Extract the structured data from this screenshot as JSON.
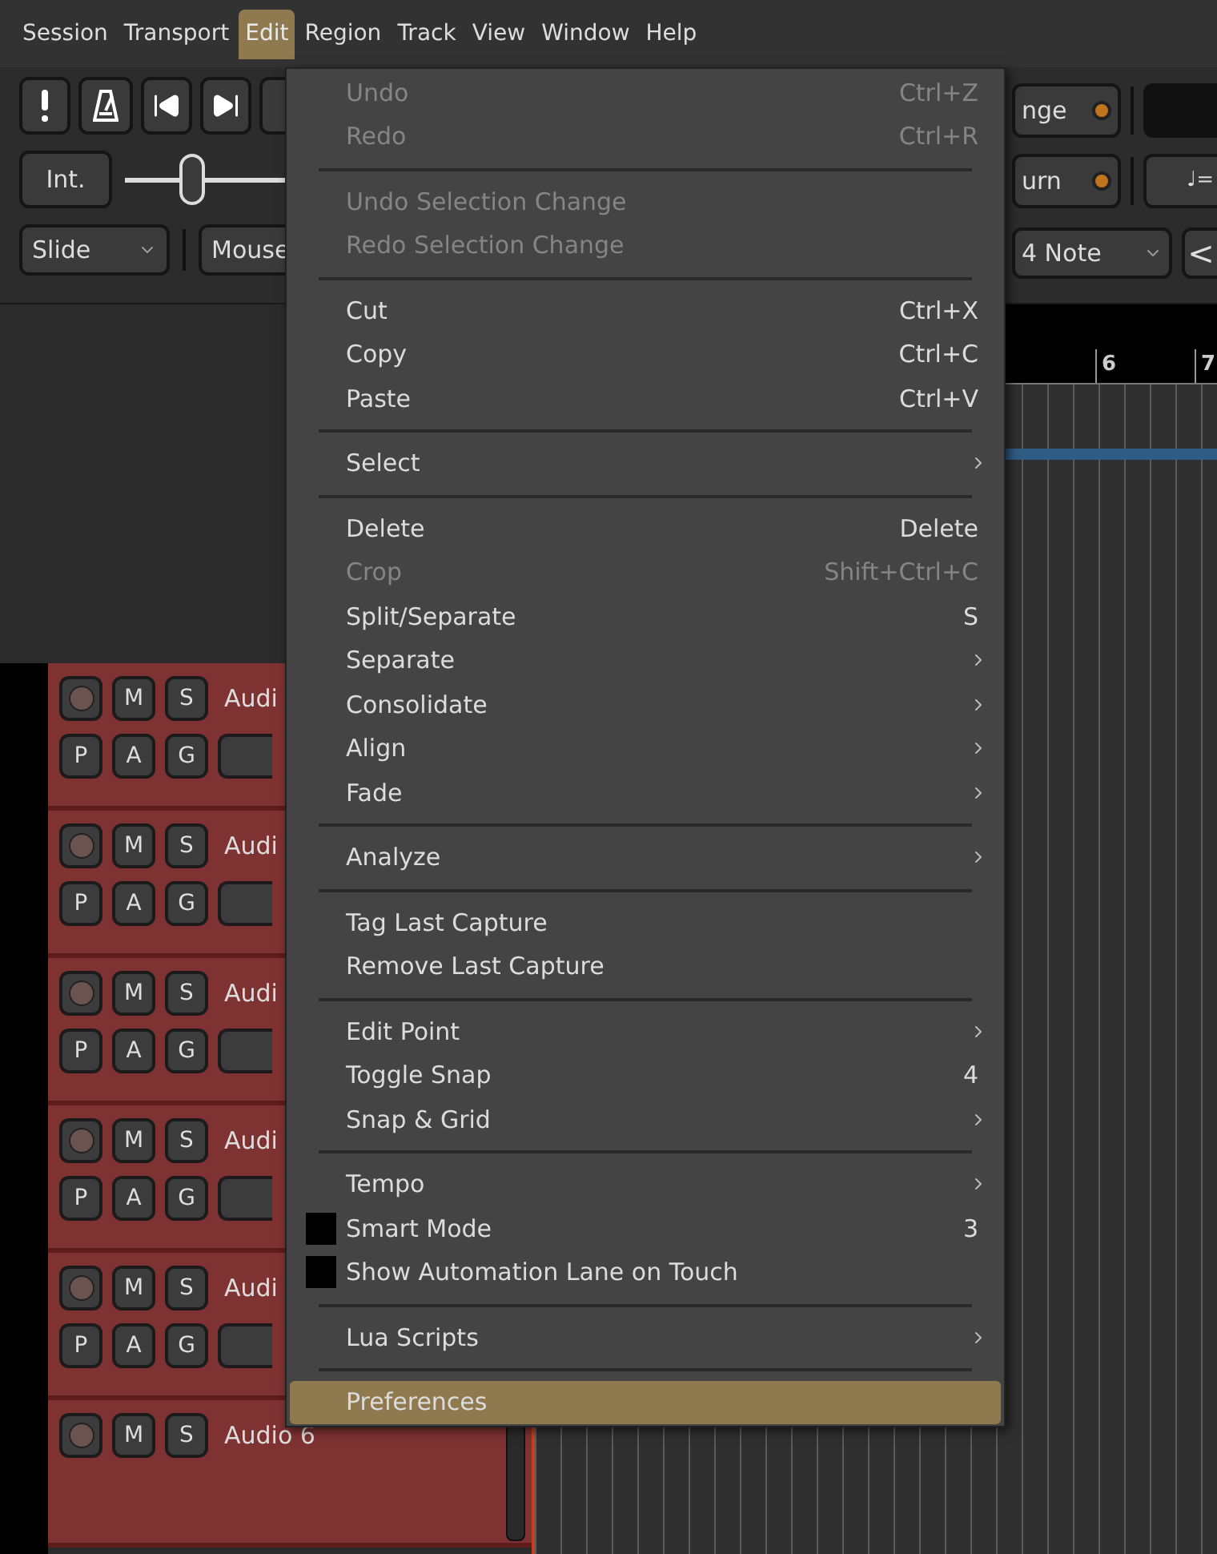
{
  "menubar": [
    {
      "label": "Session",
      "selected": false
    },
    {
      "label": "Transport",
      "selected": false
    },
    {
      "label": "Edit",
      "selected": true
    },
    {
      "label": "Region",
      "selected": false
    },
    {
      "label": "Track",
      "selected": false
    },
    {
      "label": "View",
      "selected": false
    },
    {
      "label": "Window",
      "selected": false
    },
    {
      "label": "Help",
      "selected": false
    }
  ],
  "toolbar": {
    "int_button": "Int.",
    "shuttle": {
      "level": 0.42
    },
    "range_button": "nge",
    "return_button": "urn",
    "tempo_button": "♩=",
    "edit_mode": "Slide",
    "mouse_mode": "Mouse",
    "grid_mode": "4 Note",
    "nudge_button": "<"
  },
  "ruler": {
    "labels": [
      "6",
      "7"
    ]
  },
  "tracks": [
    {
      "name": "Audi",
      "top_buttons": [
        "M",
        "S"
      ],
      "bottom_buttons": [
        "P",
        "A",
        "G"
      ]
    },
    {
      "name": "Audi",
      "top_buttons": [
        "M",
        "S"
      ],
      "bottom_buttons": [
        "P",
        "A",
        "G"
      ]
    },
    {
      "name": "Audi",
      "top_buttons": [
        "M",
        "S"
      ],
      "bottom_buttons": [
        "P",
        "A",
        "G"
      ]
    },
    {
      "name": "Audi",
      "top_buttons": [
        "M",
        "S"
      ],
      "bottom_buttons": [
        "P",
        "A",
        "G"
      ]
    },
    {
      "name": "Audi",
      "top_buttons": [
        "M",
        "S"
      ],
      "bottom_buttons": [
        "P",
        "A",
        "G"
      ]
    },
    {
      "name": "Audio 6",
      "top_buttons": [
        "M",
        "S"
      ]
    }
  ],
  "edit_menu": {
    "groups": [
      {
        "items": [
          {
            "kind": "normal",
            "label": "Undo",
            "shortcut": "Ctrl+Z",
            "disabled": true,
            "submenu": false,
            "selected": false
          },
          {
            "kind": "normal",
            "label": "Redo",
            "shortcut": "Ctrl+R",
            "disabled": true,
            "submenu": false,
            "selected": false
          }
        ]
      },
      {
        "items": [
          {
            "kind": "normal",
            "label": "Undo Selection Change",
            "disabled": true,
            "submenu": false,
            "selected": false
          },
          {
            "kind": "normal",
            "label": "Redo Selection Change",
            "disabled": true,
            "submenu": false,
            "selected": false
          }
        ]
      },
      {
        "items": [
          {
            "kind": "normal",
            "label": "Cut",
            "shortcut": "Ctrl+X",
            "disabled": false,
            "submenu": false,
            "selected": false
          },
          {
            "kind": "normal",
            "label": "Copy",
            "shortcut": "Ctrl+C",
            "disabled": false,
            "submenu": false,
            "selected": false
          },
          {
            "kind": "normal",
            "label": "Paste",
            "shortcut": "Ctrl+V",
            "disabled": false,
            "submenu": false,
            "selected": false
          }
        ]
      },
      {
        "items": [
          {
            "kind": "normal",
            "label": "Select",
            "disabled": false,
            "submenu": true,
            "selected": false
          }
        ]
      },
      {
        "items": [
          {
            "kind": "normal",
            "label": "Delete",
            "shortcut": "Delete",
            "disabled": false,
            "submenu": false,
            "selected": false
          },
          {
            "kind": "normal",
            "label": "Crop",
            "shortcut": "Shift+Ctrl+C",
            "disabled": true,
            "submenu": false,
            "selected": false
          },
          {
            "kind": "normal",
            "label": "Split/Separate",
            "shortcut": "S",
            "disabled": false,
            "submenu": false,
            "selected": false
          },
          {
            "kind": "normal",
            "label": "Separate",
            "disabled": false,
            "submenu": true,
            "selected": false
          },
          {
            "kind": "normal",
            "label": "Consolidate",
            "disabled": false,
            "submenu": true,
            "selected": false
          },
          {
            "kind": "normal",
            "label": "Align",
            "disabled": false,
            "submenu": true,
            "selected": false
          },
          {
            "kind": "normal",
            "label": "Fade",
            "disabled": false,
            "submenu": true,
            "selected": false
          }
        ]
      },
      {
        "items": [
          {
            "kind": "normal",
            "label": "Analyze",
            "disabled": false,
            "submenu": true,
            "selected": false
          }
        ]
      },
      {
        "items": [
          {
            "kind": "normal",
            "label": "Tag Last Capture",
            "disabled": false,
            "submenu": false,
            "selected": false
          },
          {
            "kind": "normal",
            "label": "Remove Last Capture",
            "disabled": false,
            "submenu": false,
            "selected": false
          }
        ]
      },
      {
        "items": [
          {
            "kind": "normal",
            "label": "Edit Point",
            "disabled": false,
            "submenu": true,
            "selected": false
          },
          {
            "kind": "normal",
            "label": "Toggle Snap",
            "shortcut": "4",
            "disabled": false,
            "submenu": false,
            "selected": false
          },
          {
            "kind": "normal",
            "label": "Snap & Grid",
            "disabled": false,
            "submenu": true,
            "selected": false
          }
        ]
      },
      {
        "items": [
          {
            "kind": "normal",
            "label": "Tempo",
            "disabled": false,
            "submenu": true,
            "selected": false
          },
          {
            "kind": "check",
            "label": "Smart Mode",
            "shortcut": "3",
            "checked": false,
            "disabled": false,
            "submenu": false,
            "selected": false
          },
          {
            "kind": "check",
            "label": "Show Automation Lane on Touch",
            "checked": false,
            "disabled": false,
            "submenu": false,
            "selected": false
          }
        ]
      },
      {
        "items": [
          {
            "kind": "normal",
            "label": "Lua Scripts",
            "disabled": false,
            "submenu": true,
            "selected": false
          }
        ]
      },
      {
        "items": [
          {
            "kind": "normal",
            "label": "Preferences",
            "disabled": false,
            "submenu": false,
            "selected": true
          }
        ]
      }
    ]
  }
}
